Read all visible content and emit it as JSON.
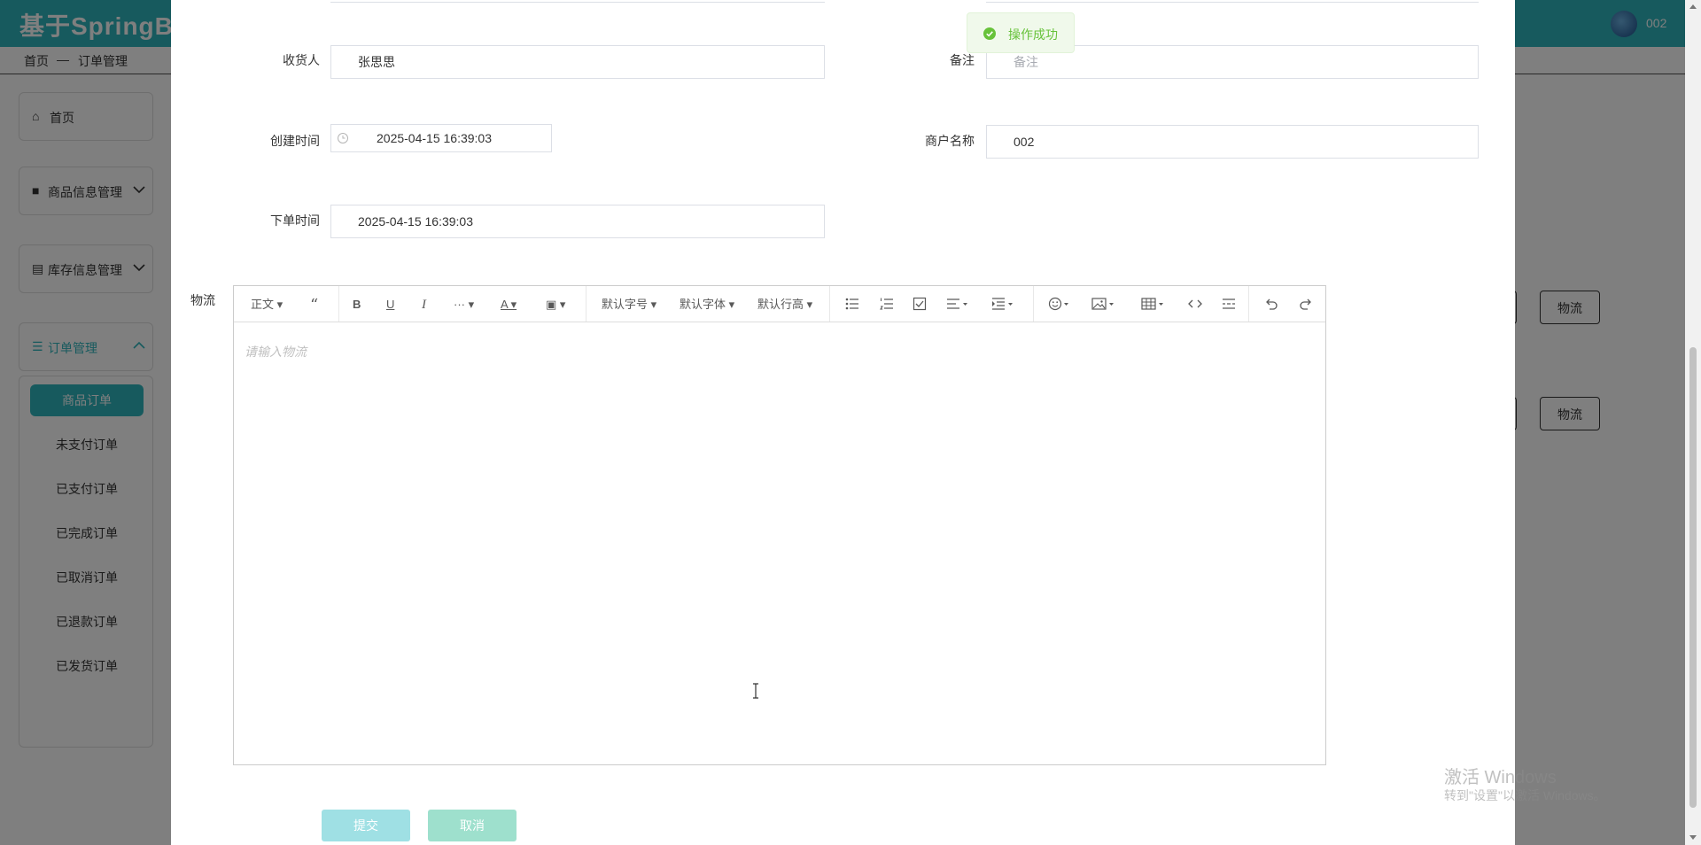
{
  "app": {
    "title": "基于SpringBo",
    "user": "002"
  },
  "breadcrumb": {
    "home": "首页",
    "separator": "—",
    "current": "订单管理"
  },
  "sidebar": {
    "home": "首页",
    "goods": "商品信息管理",
    "stock": "库存信息管理",
    "orders": "订单管理",
    "sub_items": [
      "商品订单",
      "未支付订单",
      "已支付订单",
      "已完成订单",
      "已取消订单",
      "已退款订单",
      "已发货订单"
    ]
  },
  "background_buttons": {
    "logistics": "物流"
  },
  "form": {
    "receiver_label": "收货人",
    "receiver_value": "张思思",
    "remark_label": "备注",
    "remark_placeholder": "备注",
    "created_label": "创建时间",
    "created_value": "2025-04-15 16:39:03",
    "merchant_label": "商户名称",
    "merchant_value": "002",
    "order_time_label": "下单时间",
    "order_time_value": "2025-04-15 16:39:03",
    "logistics_label": "物流",
    "logistics_placeholder": "请输入物流"
  },
  "editor_toolbar": {
    "paragraph": "正文",
    "more": "···",
    "font_size": "默认字号",
    "font_family": "默认字体",
    "line_height": "默认行高"
  },
  "buttons": {
    "submit": "提交",
    "cancel": "取消"
  },
  "toast": {
    "message": "操作成功",
    "color": "#67c23a"
  },
  "watermark": {
    "line1": "激活 Windows",
    "line2": "转到\"设置\"以激活 Windows。"
  },
  "colors": {
    "accent": "#2fb5bc"
  }
}
